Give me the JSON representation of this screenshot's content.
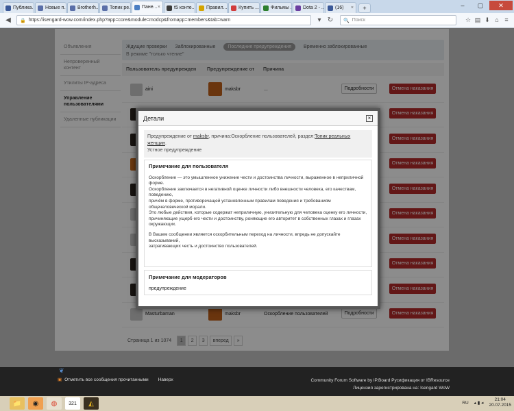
{
  "tabs": [
    {
      "label": "Публика...",
      "color": "#3b5998"
    },
    {
      "label": "Новые п...",
      "color": "#5a6fa8"
    },
    {
      "label": "Brotherh...",
      "color": "#5a6fa8"
    },
    {
      "label": "Топик ре...",
      "color": "#5a6fa8"
    },
    {
      "label": "Пане...",
      "color": "#4a7ec2",
      "active": true
    },
    {
      "label": "t5 конте...",
      "color": "#3a3a3a"
    },
    {
      "label": "Правил...",
      "color": "#d4a400"
    },
    {
      "label": "Купить ...",
      "color": "#d13b3b"
    },
    {
      "label": "Фильмы ...",
      "color": "#2d7f2d"
    },
    {
      "label": "Dota 2 - ...",
      "color": "#6b3fa0"
    },
    {
      "label": "(16)",
      "color": "#3b5998"
    }
  ],
  "browser": {
    "url": "https://isengard-wow.com/index.php?app=core&module=modcp&fromapp=members&tab=warn",
    "search_placeholder": "Поиск"
  },
  "sidebar": [
    {
      "label": "Объявления"
    },
    {
      "label": "Непроверенный контент"
    },
    {
      "label": "Утилиты IP-адреса"
    },
    {
      "label": "Управление пользователями",
      "active": true
    },
    {
      "label": "Удаленные публикации"
    }
  ],
  "filters": [
    {
      "label": "Ждущие проверки"
    },
    {
      "label": "Заблокированные"
    },
    {
      "label": "Последние предупреждения",
      "active": true
    },
    {
      "label": "Временно заблокированные"
    }
  ],
  "readonly_label": "В режиме \"только чтение\"",
  "table": {
    "headers": [
      "Пользователь предупрежден",
      "Предупреждение от",
      "Причина"
    ],
    "details_label": "Подробности",
    "revoke_label": "Отмена наказания",
    "rows": [
      {
        "user": "aini",
        "from": "maksbr",
        "reason": "...",
        "avatar": "grey"
      },
      {
        "user": "",
        "from": "",
        "reason": "",
        "avatar": "dark"
      },
      {
        "user": "",
        "from": "",
        "reason": "",
        "avatar": "dark"
      },
      {
        "user": "",
        "from": "",
        "reason": "",
        "avatar": "orange"
      },
      {
        "user": "",
        "from": "",
        "reason": "",
        "avatar": "dark"
      },
      {
        "user": "",
        "from": "",
        "reason": "",
        "avatar": "grey"
      },
      {
        "user": "",
        "from": "",
        "reason": "",
        "avatar": "grey"
      },
      {
        "user": "",
        "from": "",
        "reason": "",
        "avatar": "dark"
      },
      {
        "user": "",
        "from": "",
        "reason": "",
        "avatar": "dark"
      },
      {
        "user": "Masturbaman",
        "from": "maksbr",
        "reason": "Оскорбление пользователей",
        "avatar": "grey"
      }
    ]
  },
  "pager": {
    "label": "Страница 1 из 1074",
    "pages": [
      "1",
      "2",
      "3"
    ],
    "next": "вперед",
    "last": "»"
  },
  "modal": {
    "title": "Детали",
    "close_icon": "×",
    "info": {
      "prefix": "Предупреждение от",
      "from": "maksbr",
      "mid": ", причина:Оскорбление пользователей, раздел:",
      "section": "Топик реальных женщин",
      "suffix": ".",
      "type": "Устное предупреждение"
    },
    "user_note": {
      "heading": "Примечание для пользователя",
      "lines": [
        "Оскорбление — это умышленное унижение чести и достоинства личности, выраженное в неприличной форме.",
        "Оскорбление заключается в негативной оценке личности либо внешности человека, его качествам, поведению,",
        "причём в форме, противоречащей установленным правилам поведения и требованиям общечеловеческой морали.",
        "Это любые действия, которые содержат неприличную, унизительную для человека оценку его личности,",
        "причиняющие ущерб его чести и достоинству, роняющие его авторитет в собственных глазах и глазах окружающих."
      ],
      "lines2": [
        "В Вашем сообщении является оскорбительным переход на личности, впредь не допускайте высказываний,",
        "затрагивающих честь и достоинство пользователей."
      ]
    },
    "mod_note": {
      "heading": "Примечание для модераторов",
      "text": "предупреждение"
    }
  },
  "footer": {
    "mark_all_read": "Отметить все сообщения прочитанными",
    "top": "Наверх",
    "credit": "Community Forum Software by IP.Board Русификация от IBResource",
    "license": "Лицензия зарегистрирована на: Isengard WoW"
  },
  "taskbar": {
    "lang": "RU",
    "time": "21:04",
    "date": "20.07.2015"
  }
}
